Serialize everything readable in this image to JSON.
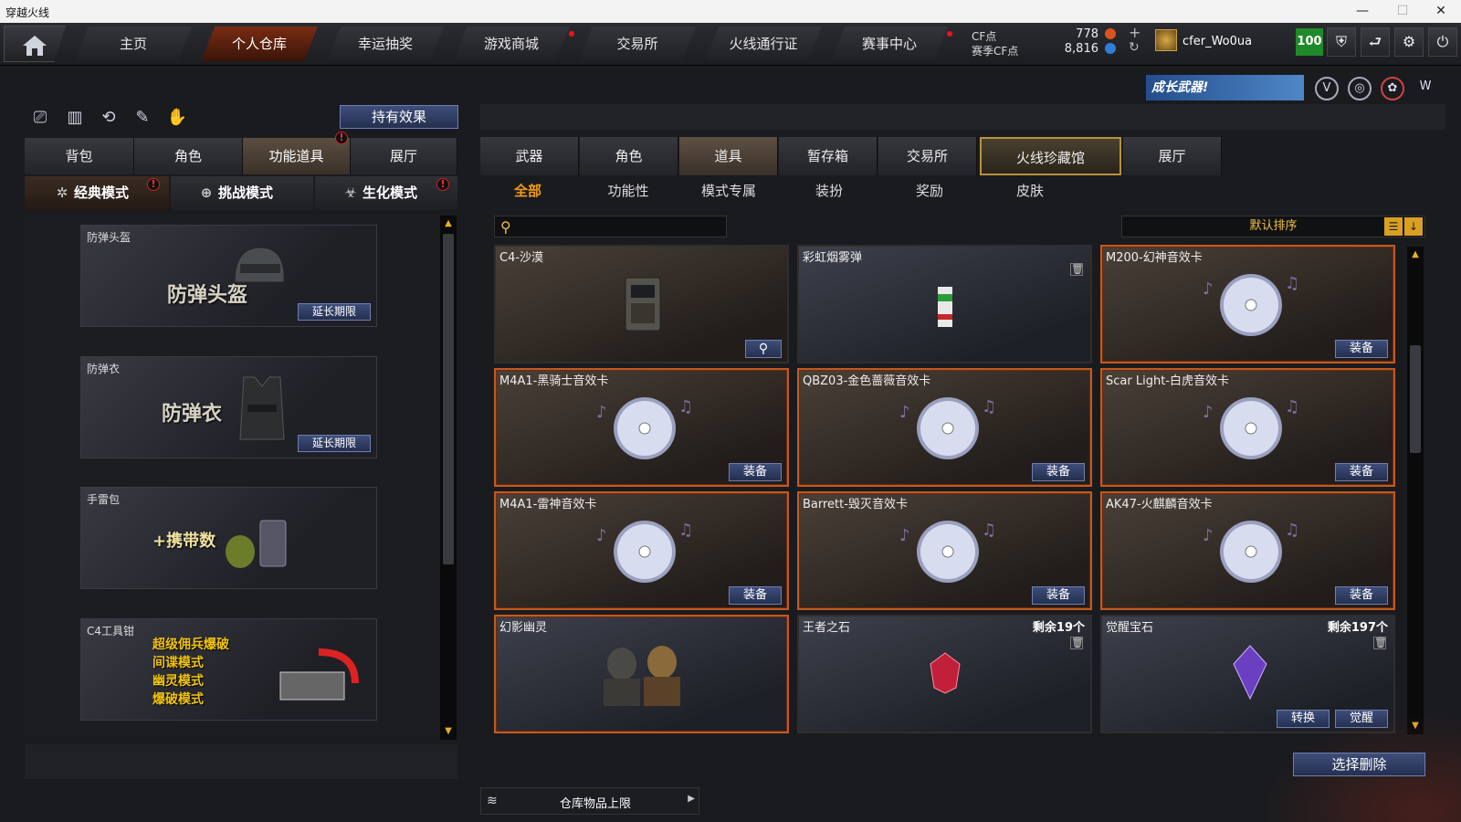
{
  "window": {
    "title": "穿越火线"
  },
  "nav": {
    "tabs": [
      "主页",
      "个人仓库",
      "幸运抽奖",
      "游戏商城",
      "交易所",
      "火线通行证",
      "赛事中心"
    ],
    "active": "个人仓库"
  },
  "account": {
    "cf_label": "CF点",
    "cf_value": "778",
    "season_cf_label": "赛季CF点",
    "season_cf_value": "8,816",
    "username": "cfer_Wo0ua",
    "level": "100"
  },
  "banner": {
    "text": "成长武器!"
  },
  "left": {
    "effect_button": "持有效果",
    "tabs": [
      "背包",
      "角色",
      "功能道具",
      "展厅"
    ],
    "active_tab": "功能道具",
    "modes": [
      "经典模式",
      "挑战模式",
      "生化模式"
    ],
    "active_mode": "经典模式",
    "items": [
      {
        "name": "防弹头盔",
        "big": "防弹头盔",
        "button": "延长期限"
      },
      {
        "name": "防弹衣",
        "big": "防弹衣",
        "button": "延长期限"
      },
      {
        "name": "手雷包",
        "big": "+携带数",
        "button": ""
      },
      {
        "name": "C4工具钳",
        "lines": [
          "超级佣兵爆破",
          "间谍模式",
          "幽灵模式",
          "爆破模式"
        ]
      }
    ]
  },
  "right": {
    "tabs": [
      "武器",
      "角色",
      "道具",
      "暂存箱",
      "交易所",
      "火线珍藏馆",
      "展厅"
    ],
    "active_tab": "道具",
    "subtabs": [
      "全部",
      "功能性",
      "模式专属",
      "装扮",
      "奖励",
      "皮肤"
    ],
    "active_subtab": "全部",
    "search_placeholder": "",
    "sort_label": "默认排序",
    "items": [
      {
        "name": "C4-沙漠"
      },
      {
        "name": "彩虹烟雾弹"
      },
      {
        "name": "M200-幻神音效卡",
        "button": "装备"
      },
      {
        "name": "M4A1-黑骑士音效卡",
        "button": "装备"
      },
      {
        "name": "QBZ03-金色蔷薇音效卡",
        "button": "装备"
      },
      {
        "name": "Scar Light-白虎音效卡",
        "button": "装备"
      },
      {
        "name": "M4A1-雷神音效卡",
        "button": "装备"
      },
      {
        "name": "Barrett-毁灭音效卡",
        "button": "装备"
      },
      {
        "name": "AK47-火麒麟音效卡",
        "button": "装备"
      },
      {
        "name": "幻影幽灵"
      },
      {
        "name": "王者之石",
        "remain": "剩余19个"
      },
      {
        "name": "觉醒宝石",
        "remain": "剩余197个",
        "btn1": "转换",
        "btn2": "觉醒"
      }
    ],
    "delete_button": "选择删除",
    "capacity_label": "仓库物品上限"
  }
}
